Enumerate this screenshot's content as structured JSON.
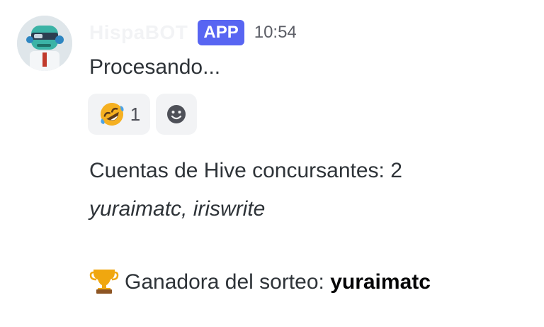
{
  "message": {
    "username": "HispaBOT",
    "badge": "APP",
    "timestamp": "10:54",
    "text_processing": "Procesando...",
    "reactions": [
      {
        "emoji": "rolling-on-the-floor-laughing",
        "count": "1"
      },
      {
        "emoji": "add-reaction"
      }
    ],
    "participants_label": "Cuentas de Hive concursantes: 2",
    "participants_list": "yuraimatc, iriswrite",
    "winner_label": "Ganadora del sorteo: ",
    "winner_name": "yuraimatc"
  },
  "colors": {
    "app_badge": "#5865f2",
    "timestamp": "#5c5e66",
    "reaction_bg": "#f2f3f5"
  }
}
